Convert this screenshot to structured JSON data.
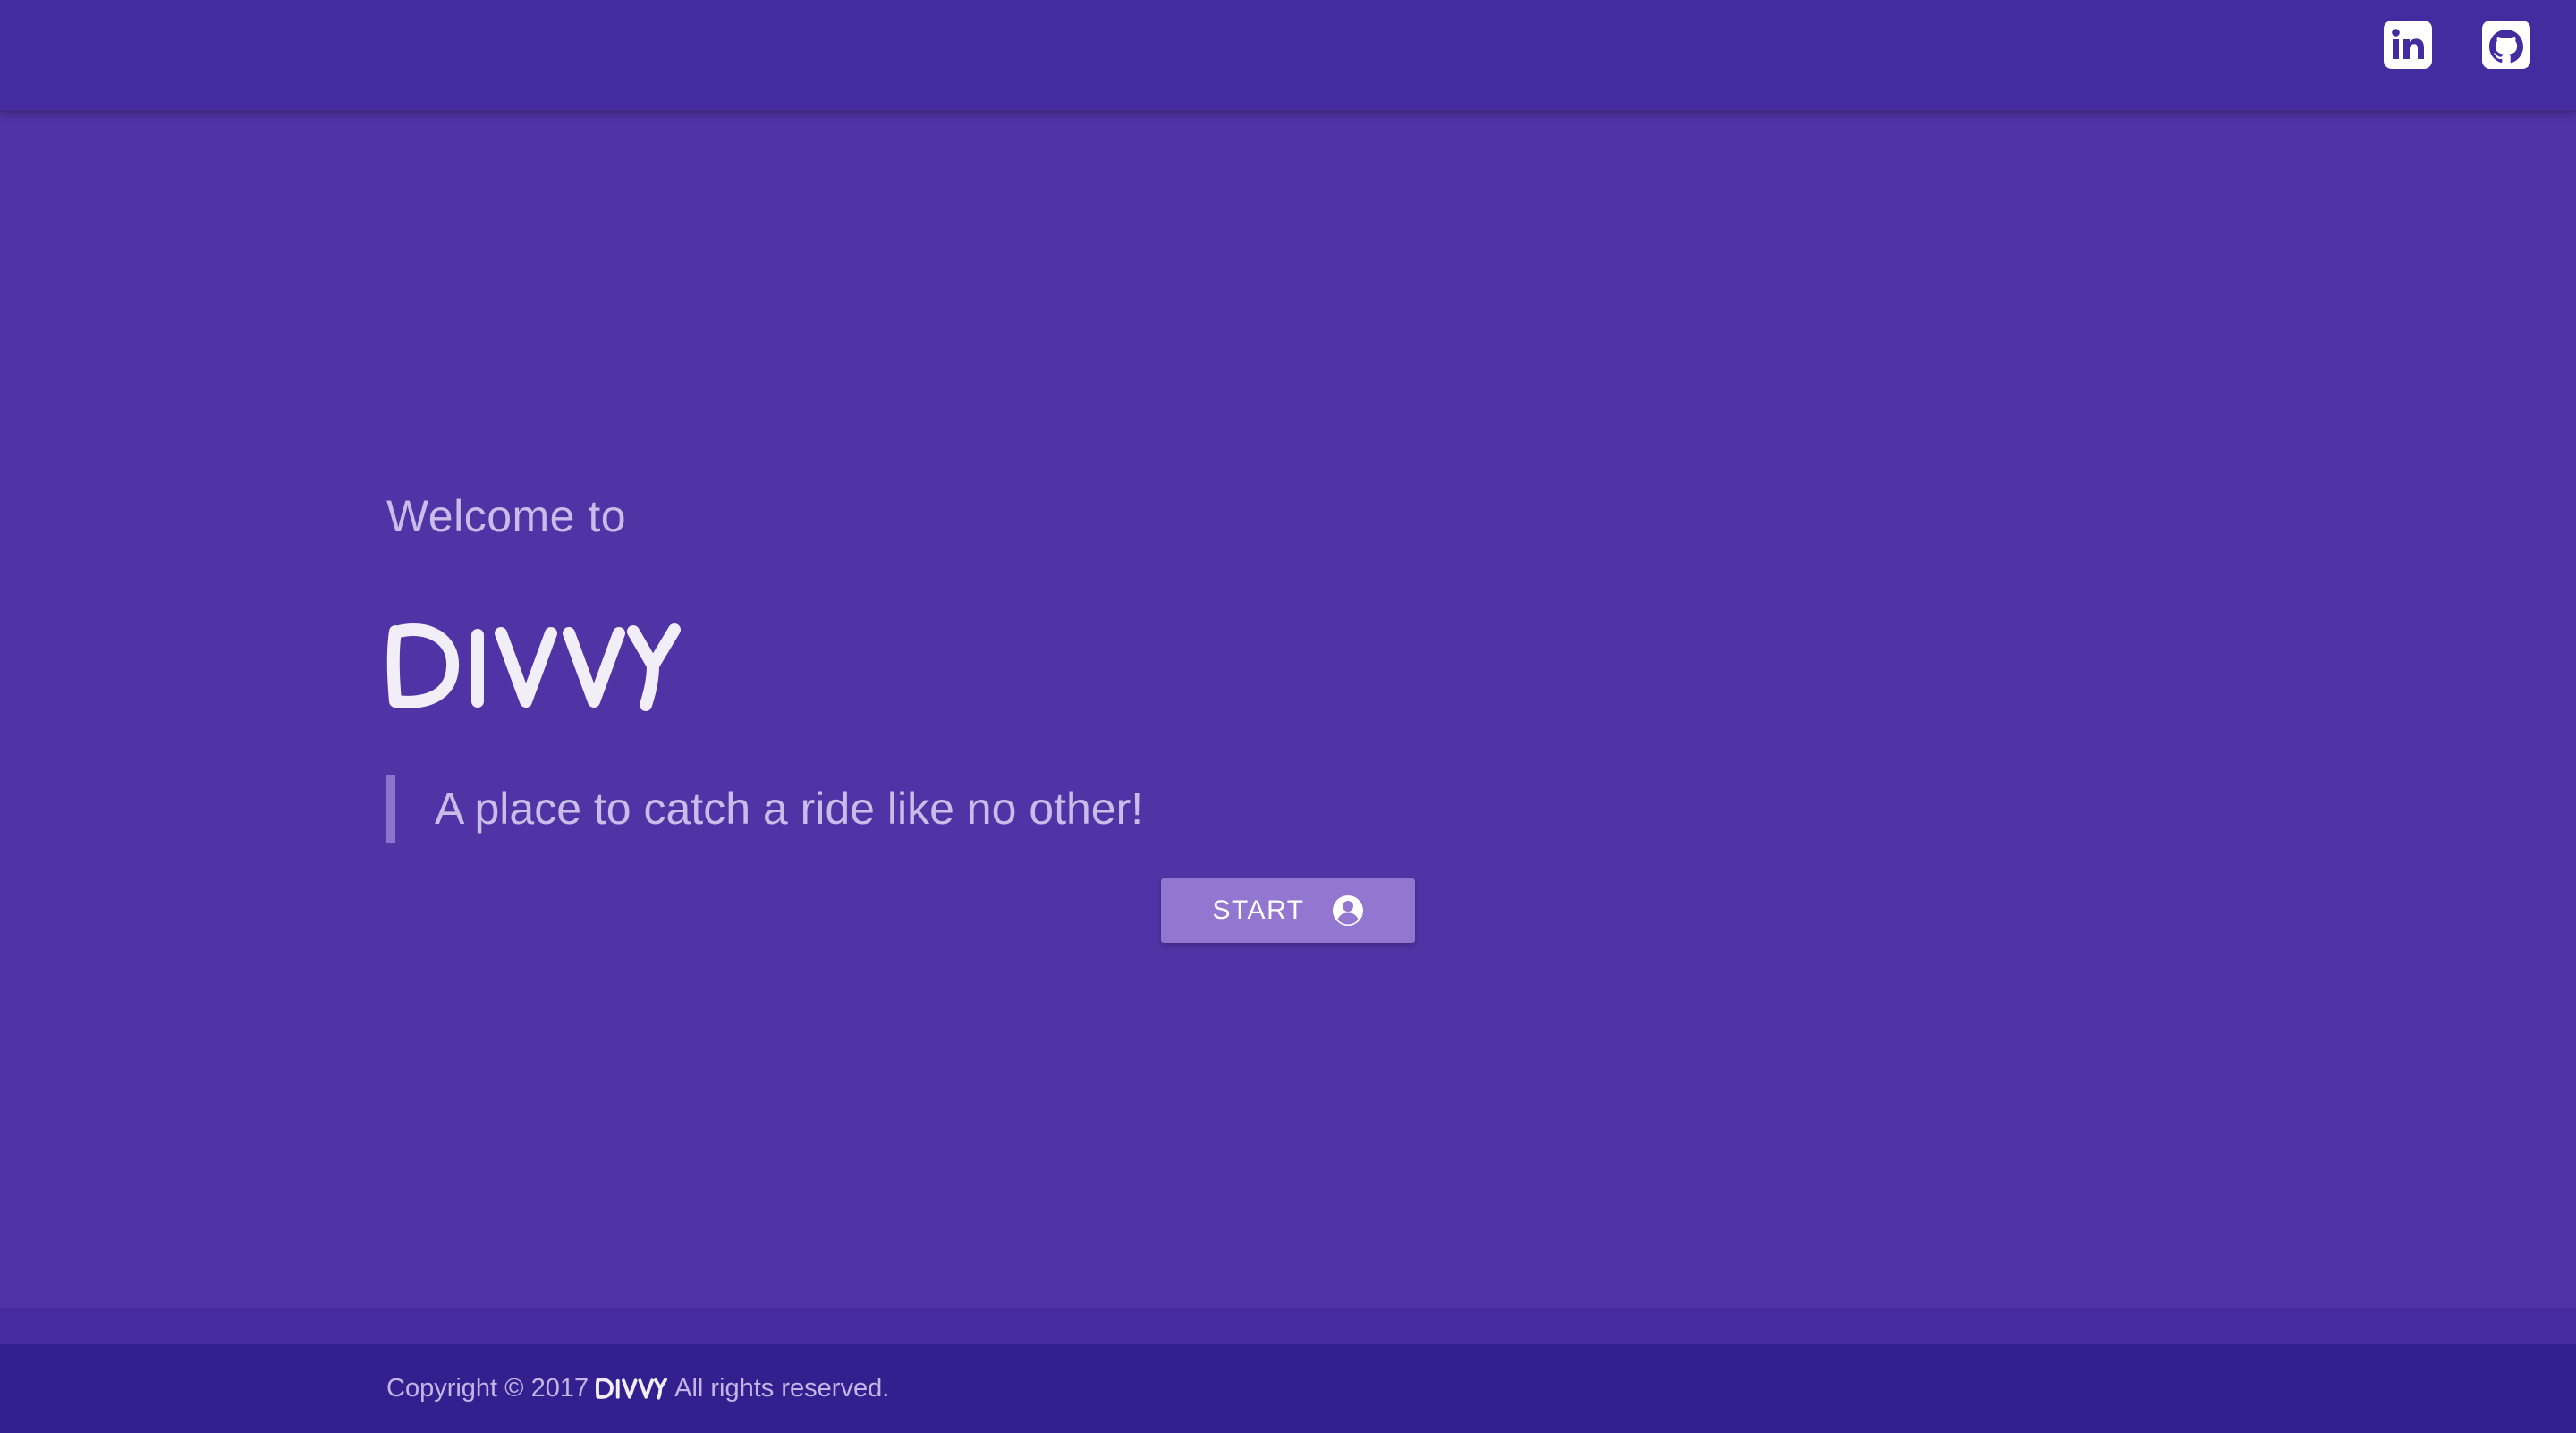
{
  "header": {
    "social": [
      {
        "icon": "linkedin-icon"
      },
      {
        "icon": "github-icon"
      }
    ]
  },
  "hero": {
    "welcome": "Welcome to",
    "brand": "DIVVY",
    "tagline": "A place to catch a ride like no other!",
    "start_button": {
      "label": "START",
      "icon": "account-circle-icon"
    }
  },
  "footer": {
    "copyright_prefix": "Copyright © 2017",
    "brand": "DIVVY",
    "copyright_suffix": "All rights reserved."
  },
  "colors": {
    "page_background": "#5033a5",
    "header_background": "#432c9f",
    "footer_background": "#32208e",
    "button_background": "#9276cf",
    "muted_text": "#c8bde9"
  }
}
